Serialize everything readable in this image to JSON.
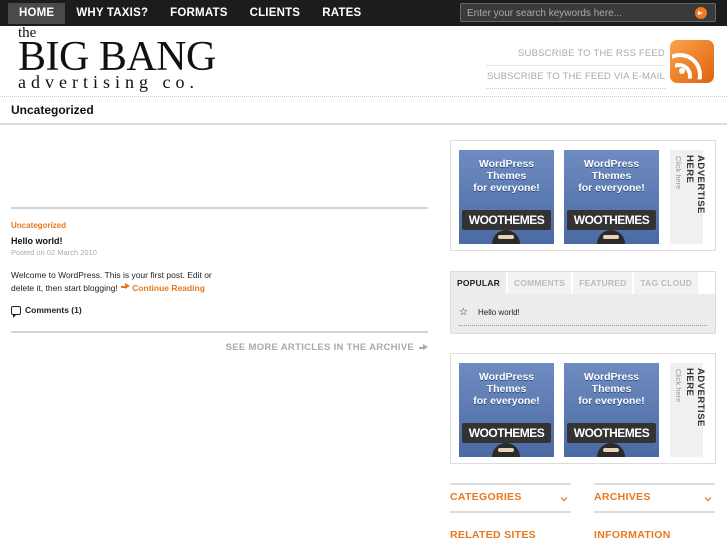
{
  "nav": {
    "items": [
      {
        "label": "HOME",
        "active": true
      },
      {
        "label": "WHY TAXIS?",
        "active": false
      },
      {
        "label": "FORMATS",
        "active": false
      },
      {
        "label": "CLIENTS",
        "active": false
      },
      {
        "label": "RATES",
        "active": false
      }
    ]
  },
  "search": {
    "placeholder": "Enter your search keywords here..."
  },
  "logo": {
    "the": "the",
    "main": "BIG BANG",
    "sub": "advertising co."
  },
  "subscribe": {
    "rss": "SUBSCRIBE TO THE RSS FEED",
    "email": "SUBSCRIBE TO THE FEED VIA E-MAIL"
  },
  "page": {
    "title": "Uncategorized"
  },
  "post": {
    "category": "Uncategorized",
    "title": "Hello world!",
    "date": "Posted on 02 March 2010",
    "excerpt": "Welcome to WordPress. This is your first post. Edit or delete it, then start blogging!",
    "continue": "Continue Reading",
    "comments": "Comments (1)"
  },
  "archive_link": "SEE MORE ARTICLES IN THE ARCHIVE",
  "ads": {
    "text_line1": "WordPress",
    "text_line2": "Themes",
    "text_line3": "for everyone!",
    "logo": "WOOTHEMES",
    "advertise": "ADVERTISE HERE",
    "click": "Click here"
  },
  "tabs": {
    "labels": [
      "POPULAR",
      "COMMENTS",
      "FEATURED",
      "TAG CLOUD"
    ],
    "popular_items": [
      "Hello world!"
    ]
  },
  "widgets": {
    "categories": "CATEGORIES",
    "archives": "ARCHIVES",
    "related": "RELATED SITES",
    "information": "INFORMATION"
  },
  "colors": {
    "accent": "#e8781e",
    "topbar": "#1c1c1c"
  }
}
